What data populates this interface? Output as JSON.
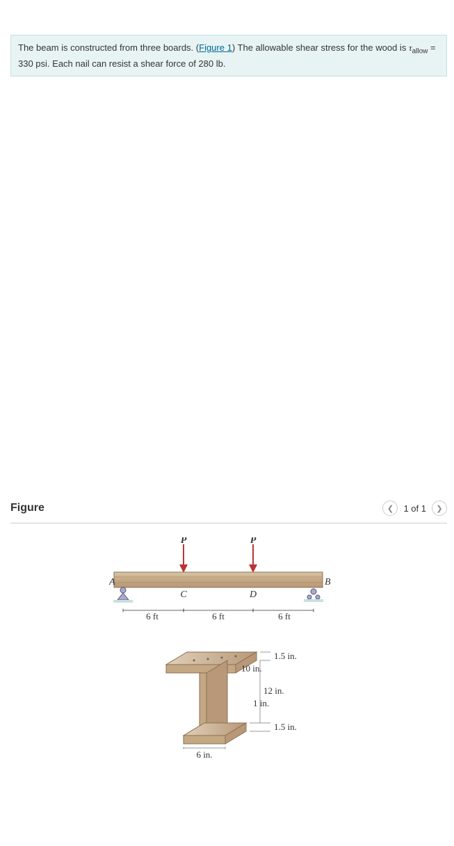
{
  "problem": {
    "text_1": "The beam is constructed from three boards. (",
    "figure_link": "Figure 1",
    "text_2": ") The allowable shear stress for the wood is ",
    "tau_var": "τ",
    "tau_sub": "allow",
    "eq": " = ",
    "tau_value": "330 psi",
    "text_3": ". Each nail can resist a shear force of ",
    "nail_force": "280 lb",
    "text_4": "."
  },
  "figure": {
    "title": "Figure",
    "pager": "1 of 1",
    "beam": {
      "load_label": "P",
      "point_A": "A",
      "point_B": "B",
      "point_C": "C",
      "point_D": "D",
      "span_1": "6 ft",
      "span_2": "6 ft",
      "span_3": "6 ft"
    },
    "section": {
      "top_width": "10 in.",
      "top_thick": "1.5 in.",
      "web_height": "12 in.",
      "web_thick": "1 in.",
      "bot_thick": "1.5 in.",
      "bot_width": "6 in."
    }
  },
  "chart_data": {
    "type": "table",
    "title": "Beam diagram and cross-section dimensions",
    "beam_spans_ft": [
      6,
      6,
      6
    ],
    "load_points": [
      "C",
      "D"
    ],
    "load_label": "P",
    "supports": [
      "A (pin)",
      "B (roller)"
    ],
    "cross_section": {
      "top_flange": {
        "width_in": 10,
        "thickness_in": 1.5
      },
      "web": {
        "height_in": 12,
        "thickness_in": 1
      },
      "bottom_flange": {
        "width_in": 6,
        "thickness_in": 1.5
      }
    },
    "allowable_shear_stress_psi": 330,
    "nail_shear_capacity_lb": 280
  }
}
